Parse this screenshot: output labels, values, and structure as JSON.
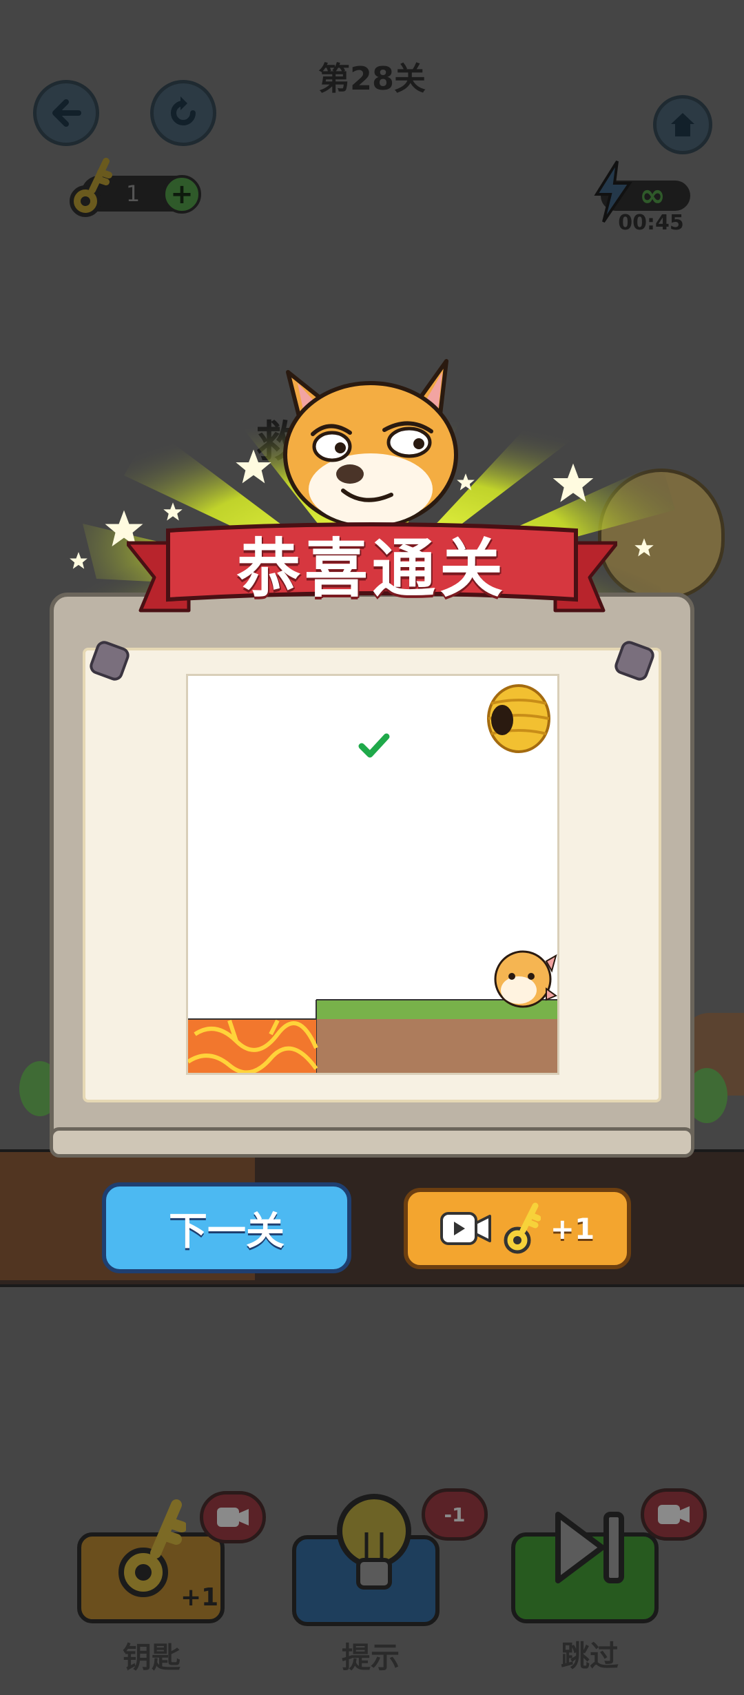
{
  "header": {
    "level_title": "第28关",
    "keys_count": "1",
    "energy_symbol": "∞",
    "timer": "00:45"
  },
  "level_goal_partial": "救",
  "dialog": {
    "banner": "恭喜通关",
    "next_button": "下一关",
    "reward_label": "+1"
  },
  "toolbar": {
    "key_label": "钥匙",
    "key_bonus": "+1",
    "hint_label": "提示",
    "hint_cost": "-1",
    "skip_label": "跳过"
  },
  "colors": {
    "background": "#454545",
    "banner_red": "#d6373f",
    "next_blue": "#4cb9f2",
    "reward_orange": "#f3a52f",
    "grass": "#78b24a",
    "dirt": "#ad7c5c",
    "lava": "#f2772d"
  },
  "icons": [
    "back-arrow-icon",
    "restart-icon",
    "home-icon",
    "key-icon",
    "plus-icon",
    "lightning-icon",
    "video-icon",
    "lightbulb-icon",
    "skip-icon",
    "checkmark-icon",
    "star-icon"
  ]
}
